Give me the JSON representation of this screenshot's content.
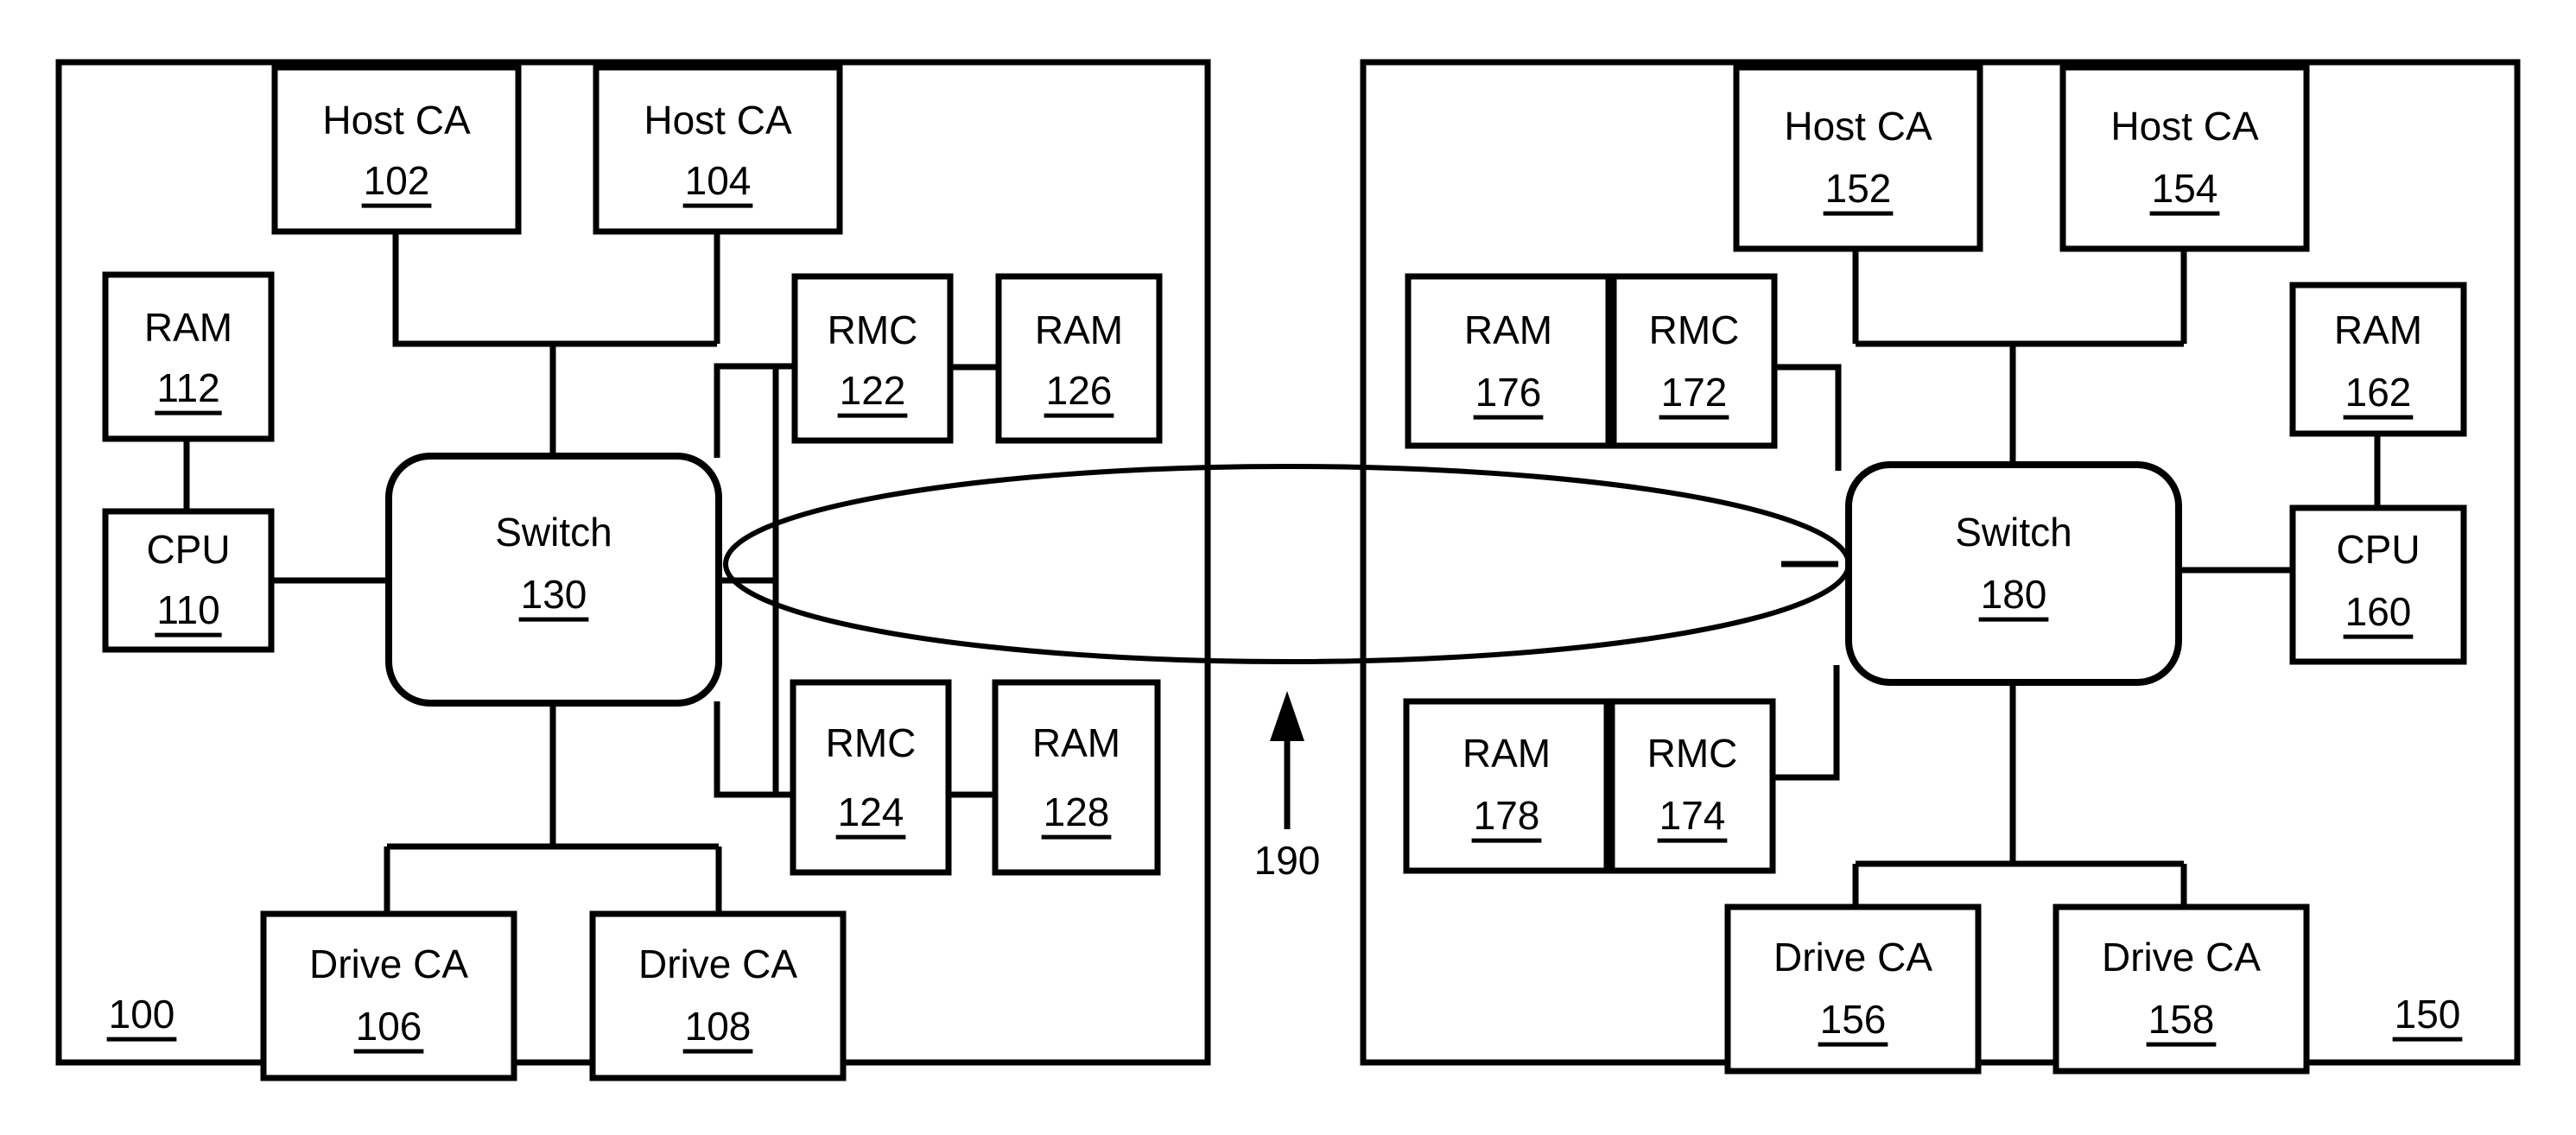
{
  "figure": {
    "title": "Dual node storage system block diagram",
    "background_color": "#ffffff",
    "line_color": "#000000"
  },
  "panels": [
    {
      "id": "left",
      "ref": "100"
    },
    {
      "id": "right",
      "ref": "150"
    }
  ],
  "interconnect": {
    "ref": "190",
    "shape": "ellipse",
    "arrow": "up-arrow"
  },
  "left_node": {
    "ref": "100",
    "blocks": [
      {
        "name": "host-ca-102",
        "label": "Host CA",
        "ref": "102"
      },
      {
        "name": "host-ca-104",
        "label": "Host CA",
        "ref": "104"
      },
      {
        "name": "ram-112",
        "label": "RAM",
        "ref": "112"
      },
      {
        "name": "cpu-110",
        "label": "CPU",
        "ref": "110"
      },
      {
        "name": "switch-130",
        "label": "Switch",
        "ref": "130"
      },
      {
        "name": "rmc-122",
        "label": "RMC",
        "ref": "122"
      },
      {
        "name": "ram-126",
        "label": "RAM",
        "ref": "126"
      },
      {
        "name": "rmc-124",
        "label": "RMC",
        "ref": "124"
      },
      {
        "name": "ram-128",
        "label": "RAM",
        "ref": "128"
      },
      {
        "name": "drive-ca-106",
        "label": "Drive CA",
        "ref": "106"
      },
      {
        "name": "drive-ca-108",
        "label": "Drive CA",
        "ref": "108"
      }
    ]
  },
  "right_node": {
    "ref": "150",
    "blocks": [
      {
        "name": "host-ca-152",
        "label": "Host CA",
        "ref": "152"
      },
      {
        "name": "host-ca-154",
        "label": "Host CA",
        "ref": "154"
      },
      {
        "name": "ram-176",
        "label": "RAM",
        "ref": "176"
      },
      {
        "name": "rmc-172",
        "label": "RMC",
        "ref": "172"
      },
      {
        "name": "ram-162",
        "label": "RAM",
        "ref": "162"
      },
      {
        "name": "cpu-160",
        "label": "CPU",
        "ref": "160"
      },
      {
        "name": "switch-180",
        "label": "Switch",
        "ref": "180"
      },
      {
        "name": "ram-178",
        "label": "RAM",
        "ref": "178"
      },
      {
        "name": "rmc-174",
        "label": "RMC",
        "ref": "174"
      },
      {
        "name": "drive-ca-156",
        "label": "Drive CA",
        "ref": "156"
      },
      {
        "name": "drive-ca-158",
        "label": "Drive CA",
        "ref": "158"
      }
    ]
  },
  "labels": {
    "host_ca": "Host CA",
    "drive_ca": "Drive CA",
    "ram": "RAM",
    "cpu": "CPU",
    "rmc": "RMC",
    "switch": "Switch"
  },
  "refs": {
    "n100": "100",
    "n102": "102",
    "n104": "104",
    "n106": "106",
    "n108": "108",
    "n110": "110",
    "n112": "112",
    "n122": "122",
    "n124": "124",
    "n126": "126",
    "n128": "128",
    "n130": "130",
    "n150": "150",
    "n152": "152",
    "n154": "154",
    "n156": "156",
    "n158": "158",
    "n160": "160",
    "n162": "162",
    "n172": "172",
    "n174": "174",
    "n176": "176",
    "n178": "178",
    "n180": "180",
    "n190": "190"
  }
}
